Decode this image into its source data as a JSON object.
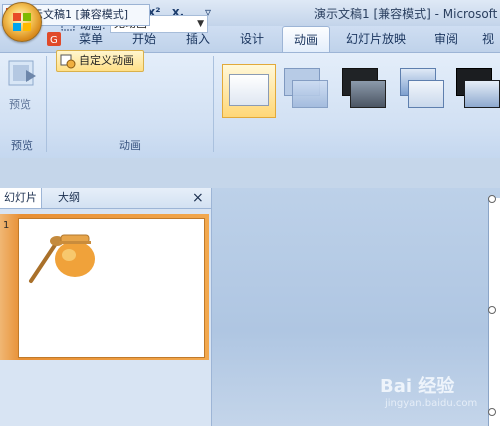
{
  "window": {
    "title": "演示文稿1 [兼容模式] - Microsoft"
  },
  "tabs": [
    "菜单",
    "开始",
    "插入",
    "设计",
    "动画",
    "幻灯片放映",
    "审阅",
    "视"
  ],
  "active_tab": "动画",
  "ribbon": {
    "preview_label": "预览",
    "preview_group_label": "预览",
    "animation_label": "动画:",
    "animation_value": "无动画",
    "custom_animation_label": "自定义动画",
    "animation_group_label": "动画"
  },
  "document_tab": "演示文稿1 [兼容模式]",
  "pane_tabs": {
    "slides": "幻灯片",
    "outline": "大纲",
    "close": "×"
  },
  "slide_number": "1",
  "watermark": {
    "brand": "Bai 经验",
    "url": "jingyan.baidu.com"
  },
  "colors": {
    "accent_orange": "#f0a043",
    "ribbon_blue": "#d1e0f3"
  },
  "icons": [
    "office-logo",
    "save-icon",
    "undo-icon",
    "redo-icon",
    "print-preview-icon",
    "superscript-icon",
    "subscript-icon",
    "qat-dropdown-icon",
    "preview-icon",
    "animation-icon",
    "custom-animation-icon",
    "transition-thumbnail",
    "doc-icon",
    "close-icon"
  ]
}
